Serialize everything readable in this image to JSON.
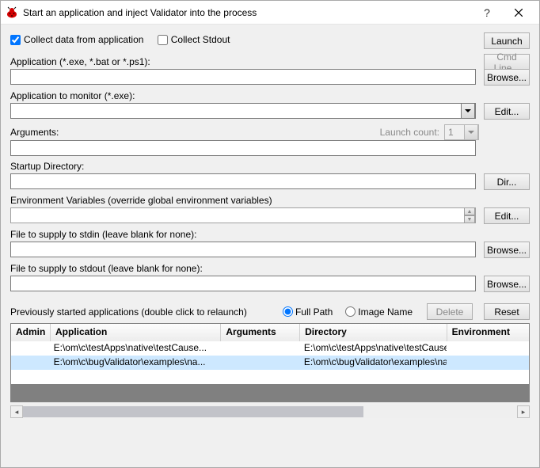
{
  "titlebar": {
    "title": "Start an application and inject Validator into the process"
  },
  "checkboxes": {
    "collect_data": "Collect data from application",
    "collect_stdout": "Collect Stdout"
  },
  "buttons": {
    "launch": "Launch",
    "cmdline": "Cmd Line...",
    "browse": "Browse...",
    "edit": "Edit...",
    "dir": "Dir...",
    "delete": "Delete",
    "reset": "Reset"
  },
  "labels": {
    "application": "Application (*.exe, *.bat or *.ps1):",
    "app_monitor": "Application to monitor (*.exe):",
    "arguments": "Arguments:",
    "launch_count": "Launch count:",
    "startup_dir": "Startup Directory:",
    "env_vars": "Environment Variables (override global environment variables)",
    "stdin": "File to supply to stdin (leave blank for none):",
    "stdout": "File to supply to stdout (leave blank for none):",
    "prev_started": "Previously started applications (double click to relaunch)",
    "full_path": "Full Path",
    "image_name": "Image Name"
  },
  "inputs": {
    "application": "",
    "app_monitor": "",
    "arguments": "",
    "launch_count": "1",
    "startup_dir": "",
    "env_vars": "",
    "stdin": "",
    "stdout": ""
  },
  "table": {
    "headers": {
      "admin": "Admin",
      "application": "Application",
      "arguments": "Arguments",
      "directory": "Directory",
      "environment": "Environment"
    },
    "rows": [
      {
        "admin": "",
        "application": "E:\\om\\c\\testApps\\native\\testCause...",
        "arguments": "",
        "directory": "E:\\om\\c\\testApps\\native\\testCause...",
        "environment": ""
      },
      {
        "admin": "",
        "application": "E:\\om\\c\\bugValidator\\examples\\na...",
        "arguments": "",
        "directory": "E:\\om\\c\\bugValidator\\examples\\na...",
        "environment": ""
      }
    ]
  }
}
